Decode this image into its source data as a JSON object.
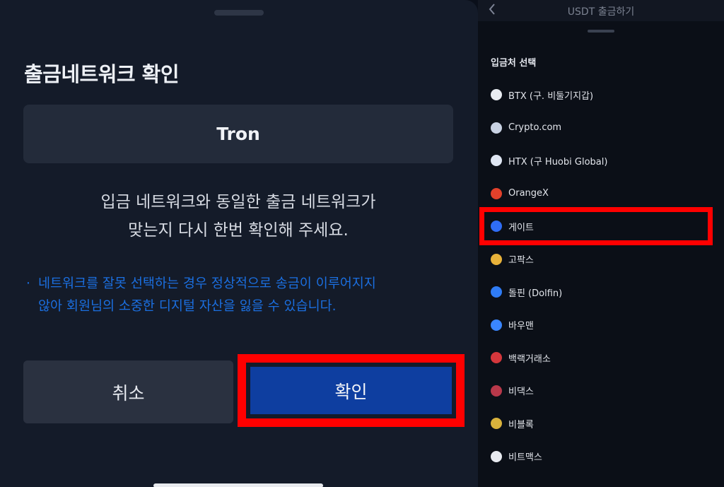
{
  "confirm_sheet": {
    "title": "출금네트워크 확인",
    "network": "Tron",
    "message_line1": "입금 네트워크와 동일한 출금 네트워크가",
    "message_line2": "맞는지 다시 한번 확인해 주세요.",
    "warning_bullet": "·",
    "warning_line1": "네트워크를 잘못 선택하는 경우 정상적으로 송금이 이루어지지",
    "warning_line2": "않아 회원님의 소중한 디지털 자산을 잃을 수 있습니다.",
    "cancel_label": "취소",
    "confirm_label": "확인",
    "highlight_color": "#ff0000",
    "confirm_color": "#0e3ea0"
  },
  "withdraw_screen": {
    "back_icon": "chevron-left-icon",
    "title": "USDT 출금하기",
    "section_title": "입금처 선택",
    "exchanges": [
      {
        "label": "BTX (구. 비둘기지갑)",
        "icon": "btx-icon",
        "color": "#e9ecf2"
      },
      {
        "label": "Crypto.com",
        "icon": "crypto-com-icon",
        "color": "#c9d2e3"
      },
      {
        "label": "HTX (구 Huobi Global)",
        "icon": "htx-icon",
        "color": "#dfe6f3"
      },
      {
        "label": "OrangeX",
        "icon": "orangex-icon",
        "color": "#e2412b"
      },
      {
        "label": "게이트",
        "icon": "gate-icon",
        "color": "#2f6df6"
      },
      {
        "label": "고팍스",
        "icon": "gopax-icon",
        "color": "#e8b23a"
      },
      {
        "label": "돌핀 (Dolfin)",
        "icon": "dolfin-icon",
        "color": "#2f7cf6"
      },
      {
        "label": "바우맨",
        "icon": "bauman-icon",
        "color": "#3a86ff"
      },
      {
        "label": "백랙거래소",
        "icon": "backrack-icon",
        "color": "#d4373c"
      },
      {
        "label": "비댁스",
        "icon": "bidax-icon",
        "color": "#b8384a"
      },
      {
        "label": "비블록",
        "icon": "biblock-icon",
        "color": "#d9b23c"
      },
      {
        "label": "비트맥스",
        "icon": "bitmax-icon",
        "color": "#e8eaf0"
      }
    ],
    "selected_index": 4
  }
}
